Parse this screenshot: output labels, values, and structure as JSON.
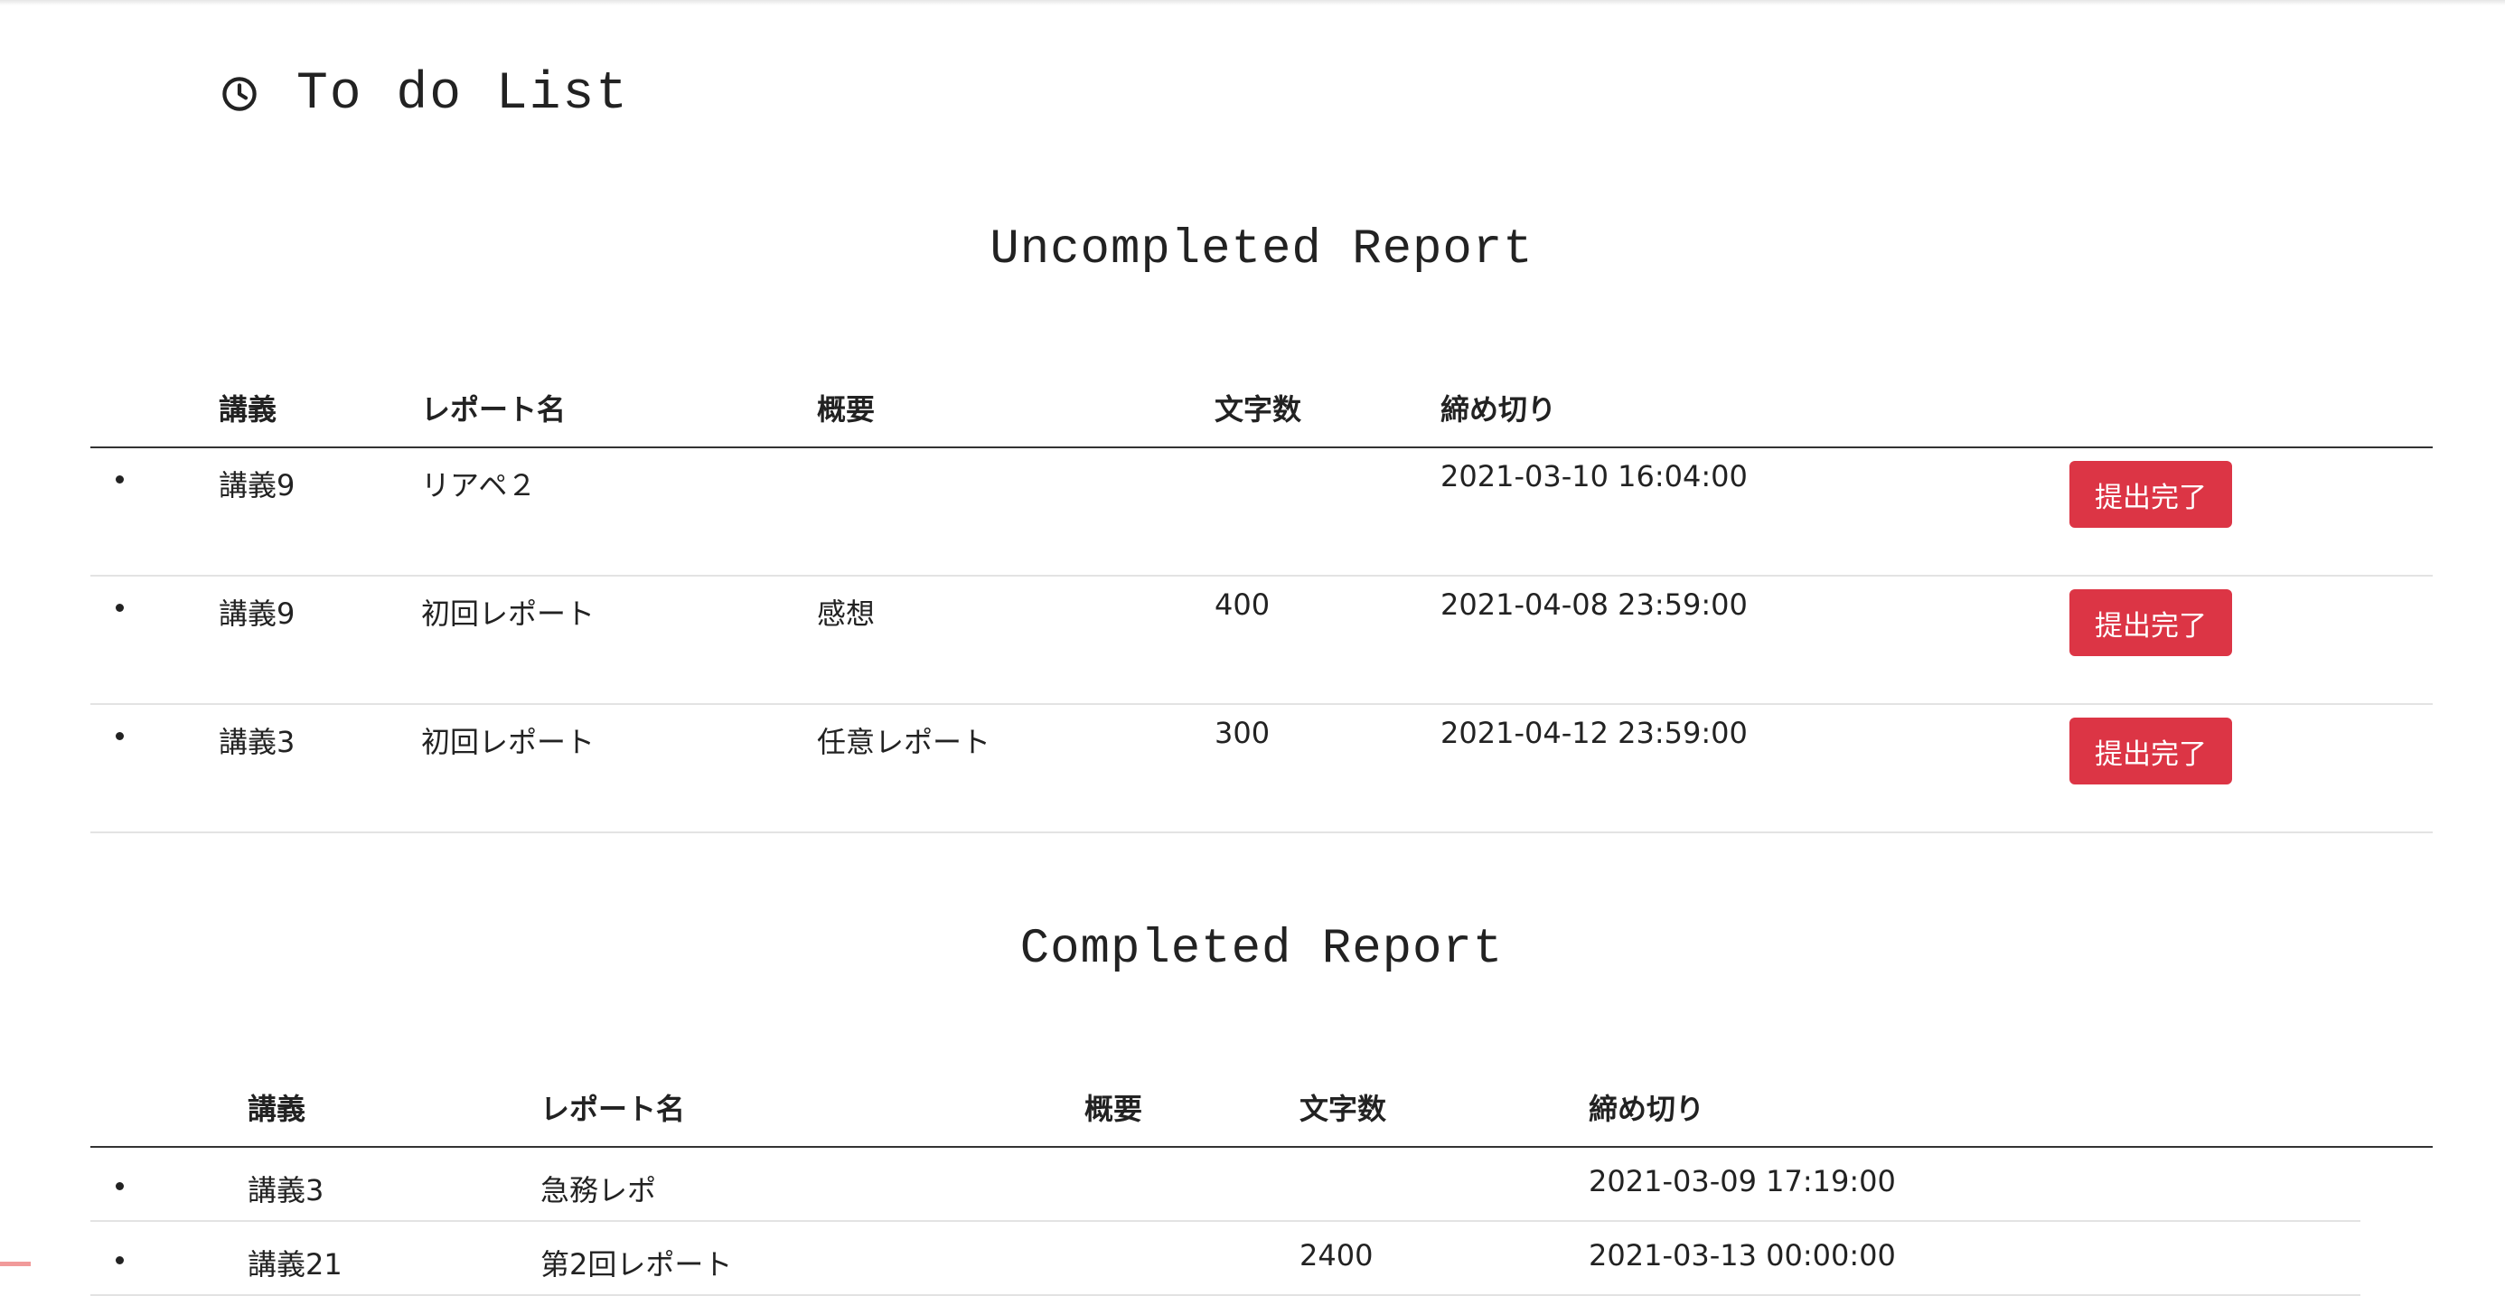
{
  "header": {
    "icon": "clock-icon",
    "title": "To do List"
  },
  "uncompleted": {
    "title": "Uncompleted Report",
    "columns": [
      "講義",
      "レポート名",
      "概要",
      "文字数",
      "締め切り"
    ],
    "rows": [
      {
        "lecture": "講義9",
        "report": "リアペ２",
        "summary": "",
        "chars": "",
        "deadline": "2021-03-10 16:04:00",
        "action": "提出完了"
      },
      {
        "lecture": "講義9",
        "report": "初回レポート",
        "summary": "感想",
        "chars": "400",
        "deadline": "2021-04-08 23:59:00",
        "action": "提出完了"
      },
      {
        "lecture": "講義3",
        "report": "初回レポート",
        "summary": "任意レポート",
        "chars": "300",
        "deadline": "2021-04-12 23:59:00",
        "action": "提出完了"
      }
    ]
  },
  "completed": {
    "title": "Completed Report",
    "columns": [
      "講義",
      "レポート名",
      "概要",
      "文字数",
      "締め切り"
    ],
    "rows": [
      {
        "lecture": "講義3",
        "report": "急務レポ",
        "summary": "",
        "chars": "",
        "deadline": "2021-03-09 17:19:00"
      },
      {
        "lecture": "講義21",
        "report": "第2回レポート",
        "summary": "",
        "chars": "2400",
        "deadline": "2021-03-13 00:00:00"
      }
    ]
  },
  "colors": {
    "danger": "#dc3545"
  }
}
